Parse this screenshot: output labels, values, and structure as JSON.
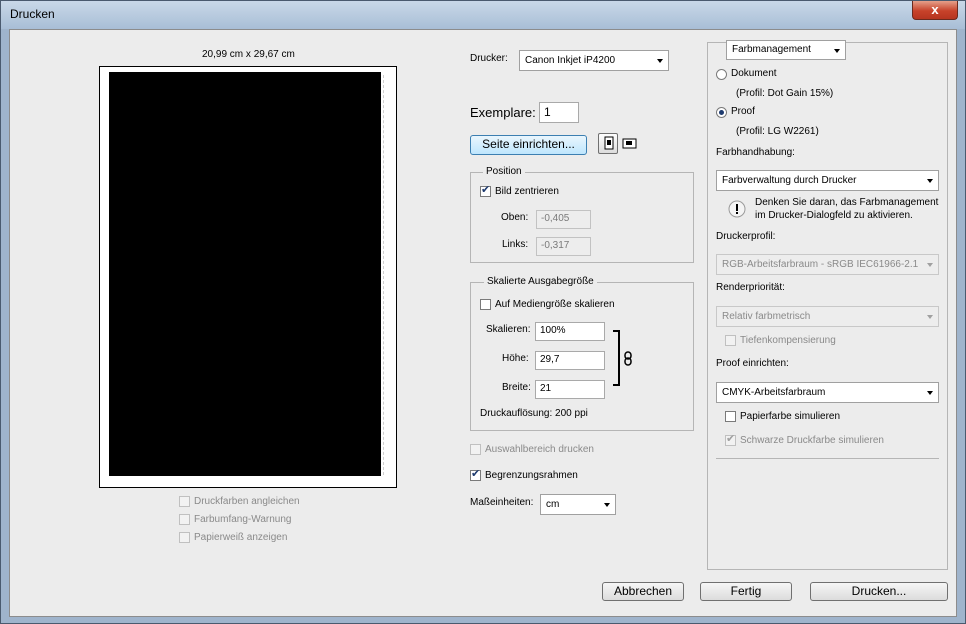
{
  "window": {
    "title": "Drucken",
    "close": "x"
  },
  "preview": {
    "size_label": "20,99 cm x 29,67 cm",
    "options": [
      {
        "label": "Druckfarben angleichen",
        "checked": false
      },
      {
        "label": "Farbumfang-Warnung",
        "checked": false
      },
      {
        "label": "Papierweiß anzeigen",
        "checked": false
      }
    ]
  },
  "printer": {
    "label": "Drucker:",
    "value": "Canon Inkjet iP4200"
  },
  "copies": {
    "label": "Exemplare:",
    "value": "1"
  },
  "page_setup": {
    "label": "Seite einrichten...",
    "portrait_icon": "portrait-orientation-icon",
    "landscape_icon": "landscape-orientation-icon"
  },
  "position": {
    "legend": "Position",
    "center_label": "Bild zentrieren",
    "center_checked": true,
    "top_label": "Oben:",
    "top_value": "-0,405",
    "left_label": "Links:",
    "left_value": "-0,317"
  },
  "scaled": {
    "legend": "Skalierte Ausgabegröße",
    "fit_label": "Auf Mediengröße skalieren",
    "fit_checked": false,
    "scale_label": "Skalieren:",
    "scale_value": "100%",
    "height_label": "Höhe:",
    "height_value": "29,7",
    "width_label": "Breite:",
    "width_value": "21",
    "link_icon": "link-icon",
    "resolution": "Druckauflösung: 200 ppi"
  },
  "print_selection": {
    "label": "Auswahlbereich drucken",
    "checked": false
  },
  "bounding_box": {
    "label": "Begrenzungsrahmen",
    "checked": true
  },
  "units": {
    "label": "Maßeinheiten:",
    "value": "cm"
  },
  "color": {
    "section": "Farbmanagement",
    "document_label": "Dokument",
    "document_profile": "(Profil: Dot Gain 15%)",
    "proof_label": "Proof",
    "proof_profile": "(Profil: LG W2261)",
    "selected": "proof",
    "handling_label": "Farbhandhabung:",
    "handling_value": "Farbverwaltung durch Drucker",
    "warning_icon": "warning-icon",
    "warning_text_1": "Denken Sie daran, das Farbmanagement",
    "warning_text_2": "im Drucker-Dialogfeld zu aktivieren.",
    "printer_profile_label": "Druckerprofil:",
    "printer_profile_value": "RGB-Arbeitsfarbraum - sRGB IEC61966-2.1",
    "render_label": "Renderpriorität:",
    "render_value": "Relativ farbmetrisch",
    "depth_label": "Tiefenkompensierung",
    "depth_checked": false,
    "proof_setup_label": "Proof einrichten:",
    "proof_setup_value": "CMYK-Arbeitsfarbraum",
    "paper_label": "Papierfarbe simulieren",
    "paper_checked": false,
    "black_label": "Schwarze Druckfarbe simulieren",
    "black_checked": true
  },
  "buttons": {
    "cancel": "Abbrechen",
    "done": "Fertig",
    "print": "Drucken..."
  }
}
